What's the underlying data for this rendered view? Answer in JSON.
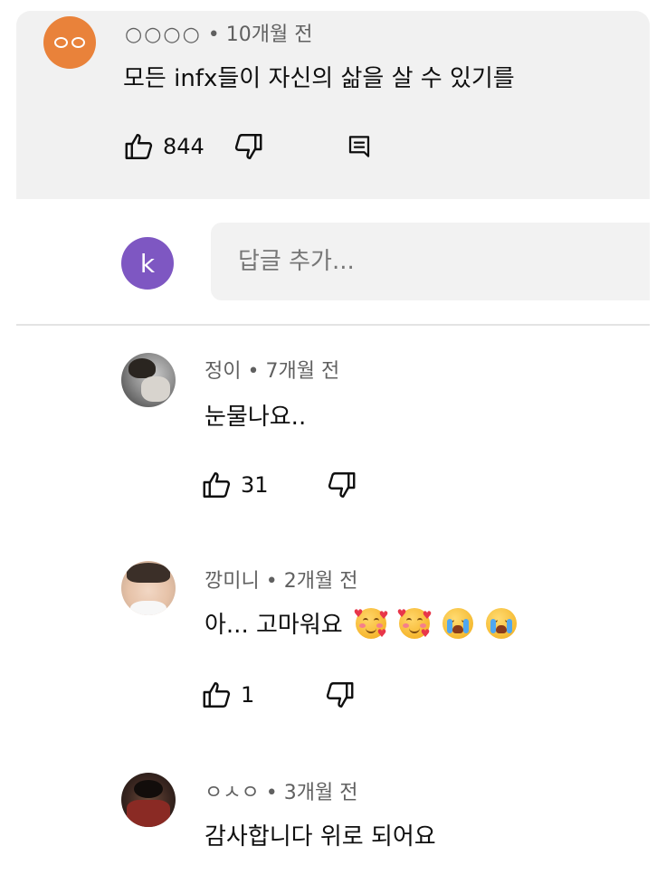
{
  "main_comment": {
    "author": "○○○○",
    "separator": "•",
    "time": "10개월 전",
    "text": "모든 infx들이 자신의 삶을 살 수 있기를",
    "likes": "844"
  },
  "reply_box": {
    "avatar_letter": "k",
    "placeholder": "답글 추가..."
  },
  "replies": [
    {
      "author": "정이",
      "separator": "•",
      "time": "7개월 전",
      "text": "눈물나요..",
      "likes": "31"
    },
    {
      "author": "깡미니",
      "separator": "•",
      "time": "2개월 전",
      "text": "아... 고마워요",
      "likes": "1",
      "emojis": [
        "smiling-face-with-hearts",
        "smiling-face-with-hearts",
        "loudly-crying-face",
        "loudly-crying-face"
      ]
    },
    {
      "author": "ㅇㅅㅇ",
      "separator": "•",
      "time": "3개월 전",
      "text": "감사합니다 위로 되어요"
    }
  ],
  "icons": {
    "like": "thumbs-up-icon",
    "dislike": "thumbs-down-icon",
    "reply": "reply-comment-icon"
  },
  "colors": {
    "main_comment_bg": "#f1f1f1",
    "orange_avatar": "#e9823a",
    "user_avatar": "#7e57c2",
    "meta_text": "#606060"
  }
}
